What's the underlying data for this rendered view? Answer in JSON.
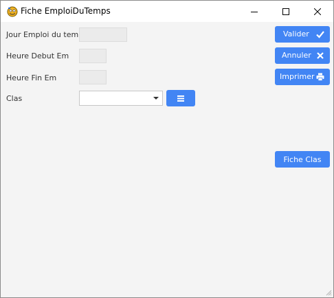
{
  "window": {
    "title": "Fiche EmploiDuTemps",
    "icon": "app-logo-icon"
  },
  "form": {
    "jour_label": "Jour Emploi du temp",
    "jour_value": "",
    "heure_debut_label": "Heure Debut Em",
    "heure_debut_value": "",
    "heure_fin_label": "Heure Fin Em",
    "heure_fin_value": "",
    "clas_label": "Clas",
    "clas_selected": ""
  },
  "buttons": {
    "valider": "Valider",
    "annuler": "Annuler",
    "imprimer": "Imprimer",
    "fiche_clas": "Fiche Clas"
  },
  "colors": {
    "accent": "#4285f4",
    "background": "#f4f4f4",
    "field": "#ebebeb"
  },
  "icons": {
    "valider": "check-icon",
    "annuler": "x-icon",
    "imprimer": "printer-icon",
    "clas_list": "list-icon"
  }
}
